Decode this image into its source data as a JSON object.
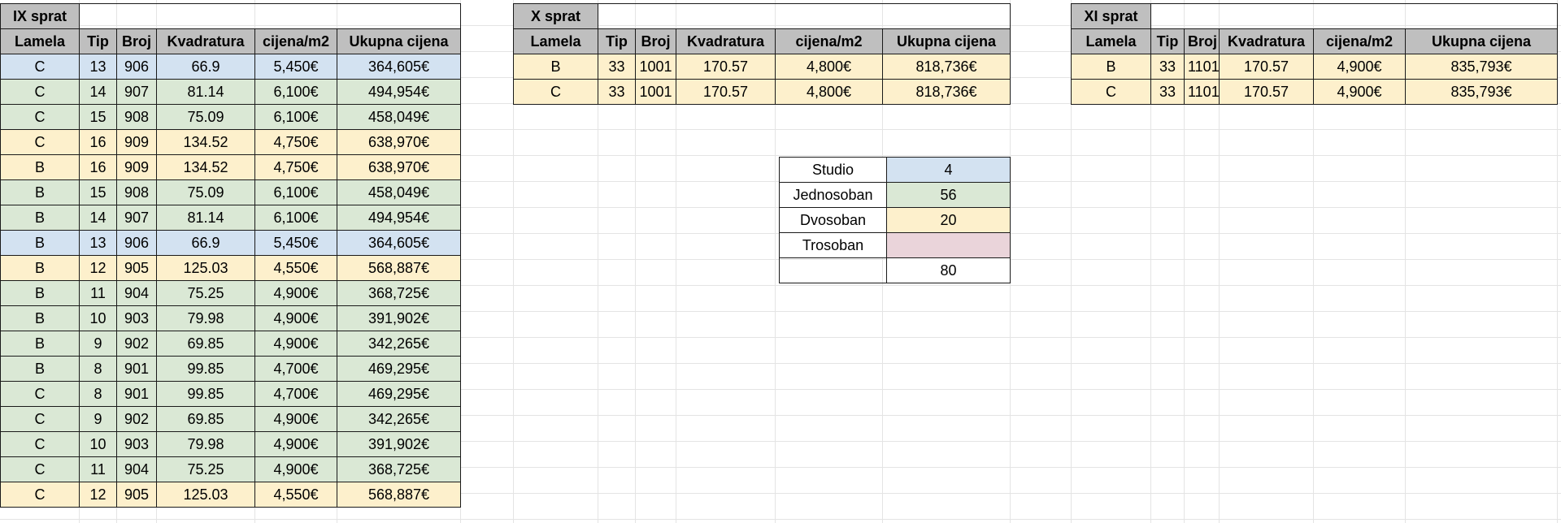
{
  "colors": {
    "header": "#bfbfbf",
    "blue": "#d3e2f1",
    "green": "#dae8d5",
    "yellow": "#fdf0cc",
    "pink": "#ead4da"
  },
  "column_headers": [
    "Lamela",
    "Tip",
    "Broj",
    "Kvadratura",
    "cijena/m2",
    "Ukupna cijena"
  ],
  "floor9": {
    "title": "IX sprat",
    "rows": [
      {
        "lamela": "C",
        "tip": "13",
        "broj": "906",
        "kvadratura": "66.9",
        "cijena": "5,450€",
        "ukupno": "364,605€",
        "color": "blue"
      },
      {
        "lamela": "C",
        "tip": "14",
        "broj": "907",
        "kvadratura": "81.14",
        "cijena": "6,100€",
        "ukupno": "494,954€",
        "color": "green"
      },
      {
        "lamela": "C",
        "tip": "15",
        "broj": "908",
        "kvadratura": "75.09",
        "cijena": "6,100€",
        "ukupno": "458,049€",
        "color": "green"
      },
      {
        "lamela": "C",
        "tip": "16",
        "broj": "909",
        "kvadratura": "134.52",
        "cijena": "4,750€",
        "ukupno": "638,970€",
        "color": "yellow"
      },
      {
        "lamela": "B",
        "tip": "16",
        "broj": "909",
        "kvadratura": "134.52",
        "cijena": "4,750€",
        "ukupno": "638,970€",
        "color": "yellow"
      },
      {
        "lamela": "B",
        "tip": "15",
        "broj": "908",
        "kvadratura": "75.09",
        "cijena": "6,100€",
        "ukupno": "458,049€",
        "color": "green"
      },
      {
        "lamela": "B",
        "tip": "14",
        "broj": "907",
        "kvadratura": "81.14",
        "cijena": "6,100€",
        "ukupno": "494,954€",
        "color": "green"
      },
      {
        "lamela": "B",
        "tip": "13",
        "broj": "906",
        "kvadratura": "66.9",
        "cijena": "5,450€",
        "ukupno": "364,605€",
        "color": "blue"
      },
      {
        "lamela": "B",
        "tip": "12",
        "broj": "905",
        "kvadratura": "125.03",
        "cijena": "4,550€",
        "ukupno": "568,887€",
        "color": "yellow"
      },
      {
        "lamela": "B",
        "tip": "11",
        "broj": "904",
        "kvadratura": "75.25",
        "cijena": "4,900€",
        "ukupno": "368,725€",
        "color": "green"
      },
      {
        "lamela": "B",
        "tip": "10",
        "broj": "903",
        "kvadratura": "79.98",
        "cijena": "4,900€",
        "ukupno": "391,902€",
        "color": "green"
      },
      {
        "lamela": "B",
        "tip": "9",
        "broj": "902",
        "kvadratura": "69.85",
        "cijena": "4,900€",
        "ukupno": "342,265€",
        "color": "green"
      },
      {
        "lamela": "B",
        "tip": "8",
        "broj": "901",
        "kvadratura": "99.85",
        "cijena": "4,700€",
        "ukupno": "469,295€",
        "color": "green"
      },
      {
        "lamela": "C",
        "tip": "8",
        "broj": "901",
        "kvadratura": "99.85",
        "cijena": "4,700€",
        "ukupno": "469,295€",
        "color": "green"
      },
      {
        "lamela": "C",
        "tip": "9",
        "broj": "902",
        "kvadratura": "69.85",
        "cijena": "4,900€",
        "ukupno": "342,265€",
        "color": "green"
      },
      {
        "lamela": "C",
        "tip": "10",
        "broj": "903",
        "kvadratura": "79.98",
        "cijena": "4,900€",
        "ukupno": "391,902€",
        "color": "green"
      },
      {
        "lamela": "C",
        "tip": "11",
        "broj": "904",
        "kvadratura": "75.25",
        "cijena": "4,900€",
        "ukupno": "368,725€",
        "color": "green"
      },
      {
        "lamela": "C",
        "tip": "12",
        "broj": "905",
        "kvadratura": "125.03",
        "cijena": "4,550€",
        "ukupno": "568,887€",
        "color": "yellow"
      }
    ]
  },
  "floor10": {
    "title": "X sprat",
    "rows": [
      {
        "lamela": "B",
        "tip": "33",
        "broj": "1001",
        "kvadratura": "170.57",
        "cijena": "4,800€",
        "ukupno": "818,736€",
        "color": "yellow"
      },
      {
        "lamela": "C",
        "tip": "33",
        "broj": "1001",
        "kvadratura": "170.57",
        "cijena": "4,800€",
        "ukupno": "818,736€",
        "color": "yellow"
      }
    ]
  },
  "floor11": {
    "title": "XI sprat",
    "rows": [
      {
        "lamela": "B",
        "tip": "33",
        "broj": "1101",
        "kvadratura": "170.57",
        "cijena": "4,900€",
        "ukupno": "835,793€",
        "color": "yellow"
      },
      {
        "lamela": "C",
        "tip": "33",
        "broj": "1101",
        "kvadratura": "170.57",
        "cijena": "4,900€",
        "ukupno": "835,793€",
        "color": "yellow"
      }
    ]
  },
  "summary": {
    "rows": [
      {
        "label": "Studio",
        "value": "4",
        "color": "blue"
      },
      {
        "label": "Jednosoban",
        "value": "56",
        "color": "green"
      },
      {
        "label": "Dvosoban",
        "value": "20",
        "color": "yellow"
      },
      {
        "label": "Trosoban",
        "value": "",
        "color": "pink"
      }
    ],
    "total": "80"
  }
}
